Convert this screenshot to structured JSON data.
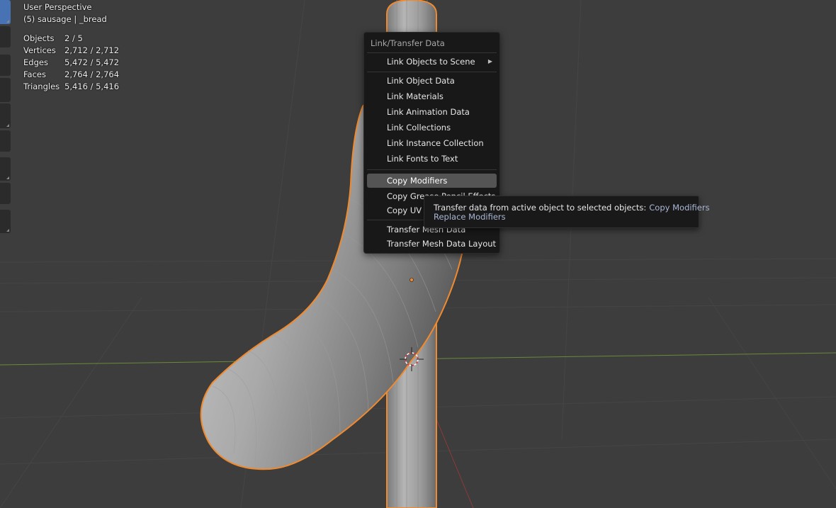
{
  "viewport": {
    "view_name": "User Perspective",
    "collection_object": "(5) sausage | _bread",
    "stats": [
      {
        "label": "Objects",
        "value": "2 / 5"
      },
      {
        "label": "Vertices",
        "value": "2,712 / 2,712"
      },
      {
        "label": "Edges",
        "value": "5,472 / 5,472"
      },
      {
        "label": "Faces",
        "value": "2,764 / 2,764"
      },
      {
        "label": "Triangles",
        "value": "5,416 / 5,416"
      }
    ]
  },
  "menu": {
    "title": "Link/Transfer Data",
    "items": [
      {
        "label": "Link Objects to Scene",
        "submenu_indicator": "▶"
      },
      {
        "label": "Link Object Data"
      },
      {
        "label": "Link Materials"
      },
      {
        "label": "Link Animation Data"
      },
      {
        "label": "Link Collections"
      },
      {
        "label": "Link Instance Collection"
      },
      {
        "label": "Link Fonts to Text"
      },
      {
        "label": "Copy Modifiers"
      },
      {
        "label": "Copy Grease Pencil Effects"
      },
      {
        "label": "Copy UV Maps"
      },
      {
        "label": "Transfer Mesh Data"
      },
      {
        "label": "Transfer Mesh Data Layout"
      }
    ]
  },
  "tooltip": {
    "description": "Transfer data from active object to selected objects:",
    "operator": "Copy Modifiers",
    "python": "Replace Modifiers"
  },
  "colors": {
    "background": "#3d3d3d",
    "selection_outline": "#f08a2e",
    "active_tool": "#4772b3",
    "menu_highlight": "#545454",
    "x_axis": "#8b3a3a",
    "y_axis": "#6a8a3a"
  }
}
